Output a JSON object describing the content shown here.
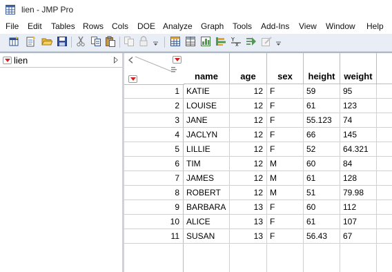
{
  "window": {
    "title": "lien - JMP Pro"
  },
  "menu": [
    "File",
    "Edit",
    "Tables",
    "Rows",
    "Cols",
    "DOE",
    "Analyze",
    "Graph",
    "Tools",
    "Add-Ins",
    "View",
    "Window",
    "Help"
  ],
  "toolbar": {
    "icons": [
      "new-data-table-icon",
      "new-script-icon",
      "open-file-icon",
      "save-icon",
      "cut-icon",
      "copy-icon",
      "paste-icon",
      "copy-disabled-icon",
      "lock-icon",
      "data-table-icon",
      "tabulate-icon",
      "distribution-icon",
      "fit-y-by-x-icon",
      "fit-model-icon",
      "graph-builder-icon"
    ],
    "accent": "#d21f1f"
  },
  "left_panel": {
    "table_name": "lien"
  },
  "table": {
    "columns": [
      "name",
      "age",
      "sex",
      "height",
      "weight"
    ],
    "rows": [
      {
        "row": "1",
        "name": "KATIE",
        "age": "12",
        "sex": "F",
        "height": "59",
        "weight": "95"
      },
      {
        "row": "2",
        "name": "LOUISE",
        "age": "12",
        "sex": "F",
        "height": "61",
        "weight": "123"
      },
      {
        "row": "3",
        "name": "JANE",
        "age": "12",
        "sex": "F",
        "height": "55.123",
        "weight": "74"
      },
      {
        "row": "4",
        "name": "JACLYN",
        "age": "12",
        "sex": "F",
        "height": "66",
        "weight": "145"
      },
      {
        "row": "5",
        "name": "LILLIE",
        "age": "12",
        "sex": "F",
        "height": "52",
        "weight": "64.321"
      },
      {
        "row": "6",
        "name": "TIM",
        "age": "12",
        "sex": "M",
        "height": "60",
        "weight": "84"
      },
      {
        "row": "7",
        "name": "JAMES",
        "age": "12",
        "sex": "M",
        "height": "61",
        "weight": "128"
      },
      {
        "row": "8",
        "name": "ROBERT",
        "age": "12",
        "sex": "M",
        "height": "51",
        "weight": "79.98"
      },
      {
        "row": "9",
        "name": "BARBARA",
        "age": "13",
        "sex": "F",
        "height": "60",
        "weight": "112"
      },
      {
        "row": "10",
        "name": "ALICE",
        "age": "13",
        "sex": "F",
        "height": "61",
        "weight": "107"
      },
      {
        "row": "11",
        "name": "SUSAN",
        "age": "13",
        "sex": "F",
        "height": "56.43",
        "weight": "67"
      }
    ]
  }
}
